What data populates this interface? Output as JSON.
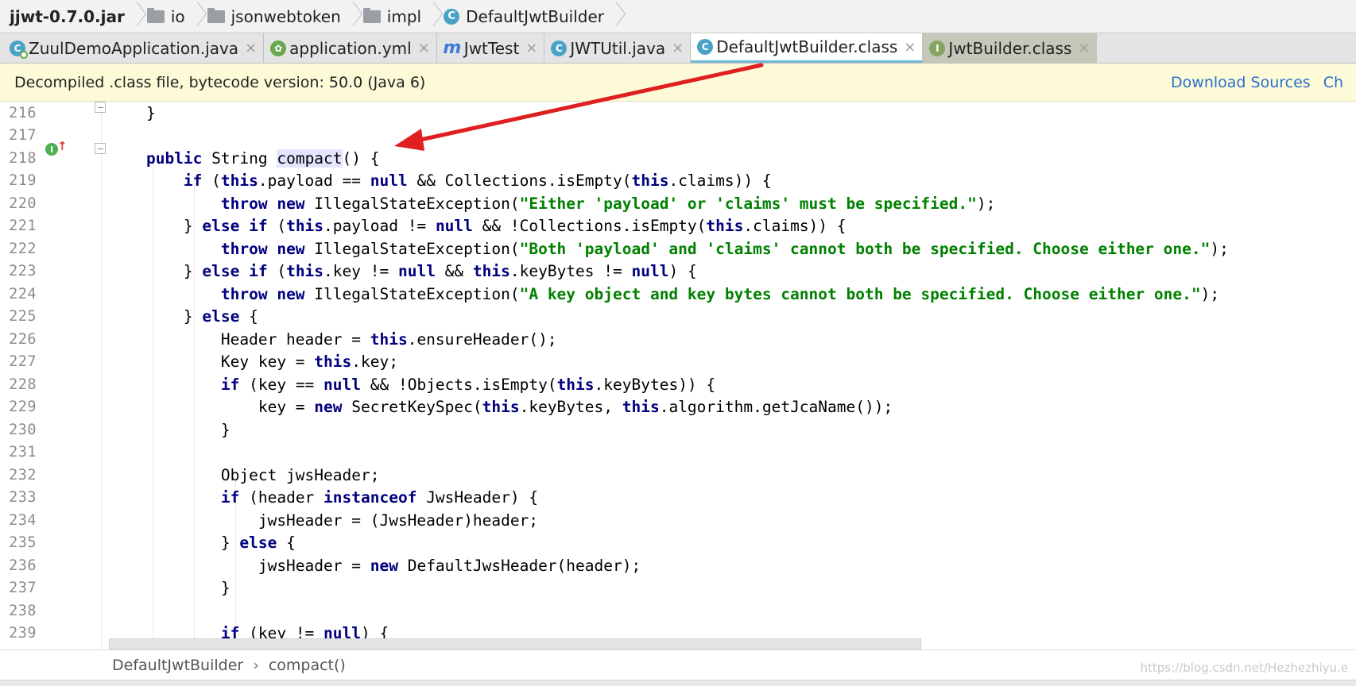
{
  "breadcrumb": {
    "items": [
      {
        "label": "jjwt-0.7.0.jar",
        "icon": "none"
      },
      {
        "label": "io",
        "icon": "folder-icon"
      },
      {
        "label": "jsonwebtoken",
        "icon": "folder-icon"
      },
      {
        "label": "impl",
        "icon": "folder-icon"
      },
      {
        "label": "DefaultJwtBuilder",
        "icon": "class-icon"
      }
    ]
  },
  "tabs": [
    {
      "label": "ZuulDemoApplication.java",
      "icon": "spring-class-icon",
      "close": "×"
    },
    {
      "label": "application.yml",
      "icon": "spring-config-icon",
      "close": "×"
    },
    {
      "label": "JwtTest",
      "icon": "m-icon",
      "close": "×"
    },
    {
      "label": "JWTUtil.java",
      "icon": "class-icon",
      "close": "×"
    },
    {
      "label": "DefaultJwtBuilder.class",
      "icon": "class-icon",
      "close": "×",
      "active": true
    },
    {
      "label": "JwtBuilder.class",
      "icon": "interface-icon",
      "close": "×"
    }
  ],
  "notice": {
    "text": "Decompiled .class file, bytecode version: 50.0 (Java 6)",
    "download_sources": "Download Sources",
    "choose_sources": "Ch"
  },
  "code": {
    "lines": [
      {
        "n": "216",
        "text": "    }"
      },
      {
        "n": "217",
        "text": ""
      },
      {
        "n": "218",
        "text": "    public String compact() {"
      },
      {
        "n": "219",
        "text": "        if (this.payload == null && Collections.isEmpty(this.claims)) {"
      },
      {
        "n": "220",
        "text": "            throw new IllegalStateException(\"Either 'payload' or 'claims' must be specified.\");"
      },
      {
        "n": "221",
        "text": "        } else if (this.payload != null && !Collections.isEmpty(this.claims)) {"
      },
      {
        "n": "222",
        "text": "            throw new IllegalStateException(\"Both 'payload' and 'claims' cannot both be specified. Choose either one.\");"
      },
      {
        "n": "223",
        "text": "        } else if (this.key != null && this.keyBytes != null) {"
      },
      {
        "n": "224",
        "text": "            throw new IllegalStateException(\"A key object and key bytes cannot both be specified. Choose either one.\");"
      },
      {
        "n": "225",
        "text": "        } else {"
      },
      {
        "n": "226",
        "text": "            Header header = this.ensureHeader();"
      },
      {
        "n": "227",
        "text": "            Key key = this.key;"
      },
      {
        "n": "228",
        "text": "            if (key == null && !Objects.isEmpty(this.keyBytes)) {"
      },
      {
        "n": "229",
        "text": "                key = new SecretKeySpec(this.keyBytes, this.algorithm.getJcaName());"
      },
      {
        "n": "230",
        "text": "            }"
      },
      {
        "n": "231",
        "text": ""
      },
      {
        "n": "232",
        "text": "            Object jwsHeader;"
      },
      {
        "n": "233",
        "text": "            if (header instanceof JwsHeader) {"
      },
      {
        "n": "234",
        "text": "                jwsHeader = (JwsHeader)header;"
      },
      {
        "n": "235",
        "text": "            } else {"
      },
      {
        "n": "236",
        "text": "                jwsHeader = new DefaultJwsHeader(header);"
      },
      {
        "n": "237",
        "text": "            }"
      },
      {
        "n": "238",
        "text": ""
      },
      {
        "n": "239",
        "text": "            if (key != null) {"
      }
    ]
  },
  "bottom": {
    "class_name": "DefaultJwtBuilder",
    "separator": "›",
    "method_name": "compact()",
    "watermark": "https://blog.csdn.net/Hezhezhiyu.e"
  },
  "colors": {
    "keyword": "#000080",
    "string": "#008000",
    "arrow": "#e02020",
    "link": "#2a6fce",
    "notice_bg": "#fdfbd7"
  }
}
